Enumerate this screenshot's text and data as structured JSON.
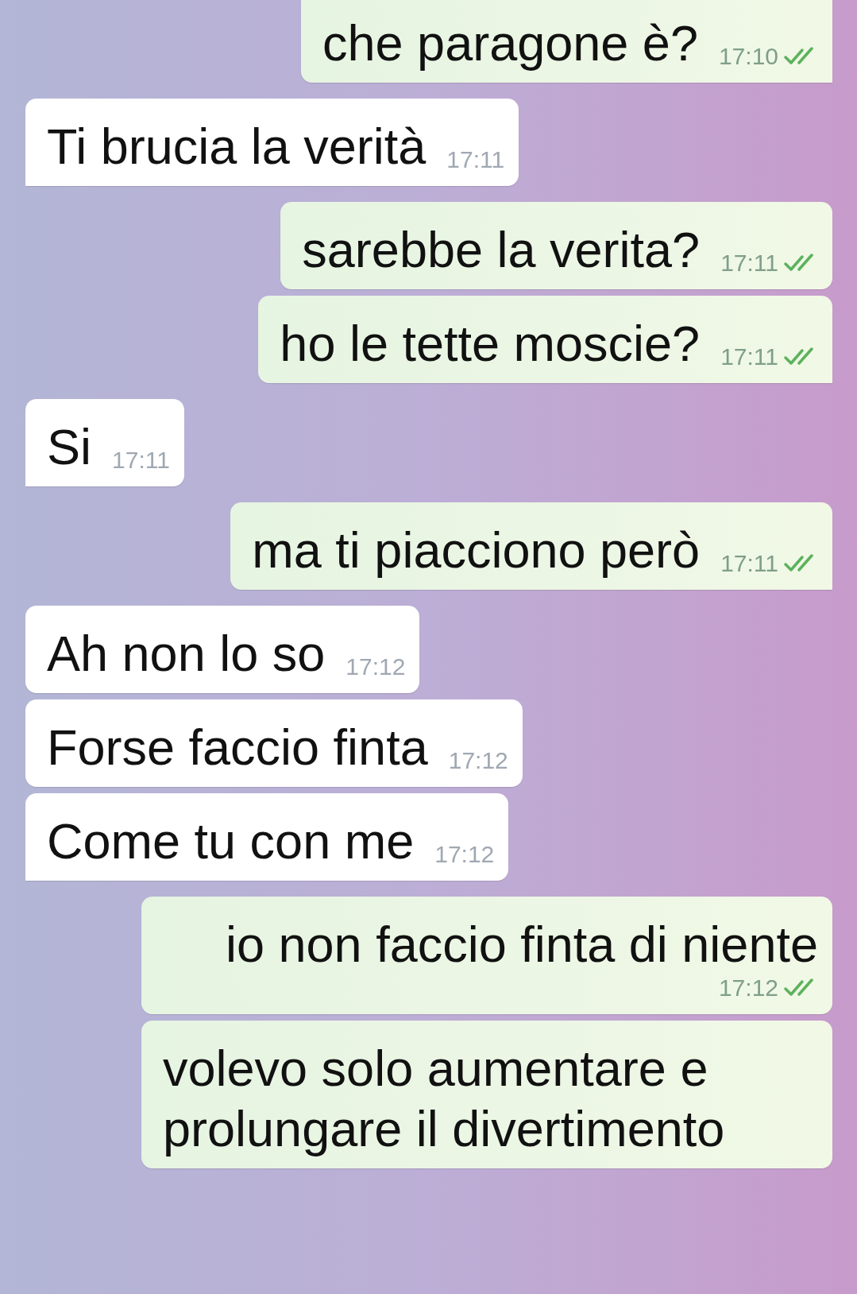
{
  "messages": [
    {
      "kind": "out",
      "text": "che paragone è?",
      "time": "17:10",
      "read": true,
      "tail": true
    },
    {
      "kind": "in",
      "text": "Ti brucia la verità",
      "time": "17:11",
      "tail": true
    },
    {
      "kind": "out",
      "text": "sarebbe la verita?",
      "time": "17:11",
      "read": true,
      "tail": false
    },
    {
      "kind": "out",
      "text": "ho le tette moscie?",
      "time": "17:11",
      "read": true,
      "tail": true
    },
    {
      "kind": "in",
      "text": "Si",
      "time": "17:11",
      "tail": true
    },
    {
      "kind": "out",
      "text": "ma ti piacciono però",
      "time": "17:11",
      "read": true,
      "tail": true
    },
    {
      "kind": "in",
      "text": "Ah non lo so",
      "time": "17:12",
      "tail": false
    },
    {
      "kind": "in",
      "text": "Forse faccio finta",
      "time": "17:12",
      "tail": false
    },
    {
      "kind": "in",
      "text": "Come tu con me",
      "time": "17:12",
      "tail": true
    },
    {
      "kind": "out",
      "text": "io non faccio finta di niente",
      "time": "17:12",
      "read": true,
      "tail": false
    },
    {
      "kind": "out",
      "text": "volevo solo aumentare e prolungare il divertimento",
      "tail": false
    }
  ]
}
